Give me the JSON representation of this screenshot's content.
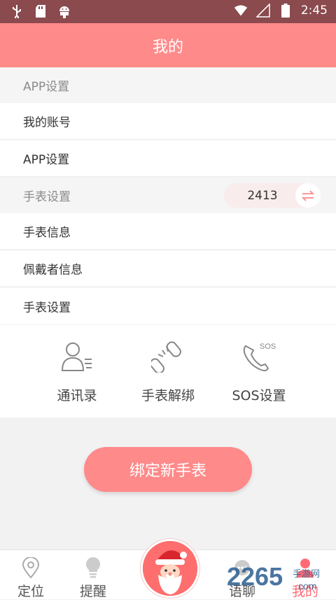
{
  "status_bar": {
    "time": "2:45",
    "icons": [
      "usb-icon",
      "sd-card-icon",
      "android-icon",
      "wifi-icon",
      "signal-icon",
      "battery-icon"
    ]
  },
  "header": {
    "title": "我的"
  },
  "app_section": {
    "title": "APP设置",
    "items": [
      "我的账号",
      "APP设置"
    ]
  },
  "watch_section": {
    "title": "手表设置",
    "selected_watch": "2413",
    "items": [
      "手表信息",
      "佩戴者信息",
      "手表设置"
    ]
  },
  "quick_actions": [
    {
      "label": "通讯录",
      "icon": "contacts-icon"
    },
    {
      "label": "手表解绑",
      "icon": "unbind-icon"
    },
    {
      "label": "SOS设置",
      "icon": "sos-phone-icon"
    }
  ],
  "bind_button": "绑定新手表",
  "tabbar": {
    "items": [
      {
        "label": "定位",
        "icon": "location-icon"
      },
      {
        "label": "提醒",
        "icon": "bulb-icon"
      },
      {
        "label": "语聊",
        "icon": "chat-icon"
      },
      {
        "label": "我的",
        "icon": "user-icon"
      }
    ],
    "active": "我的"
  },
  "watermark": {
    "text": "2265",
    "suffix": "手游网",
    "domain": "com"
  },
  "colors": {
    "brand": "#ff8a8a",
    "status_bar": "#8a4a4e",
    "active": "#ff6b75"
  }
}
